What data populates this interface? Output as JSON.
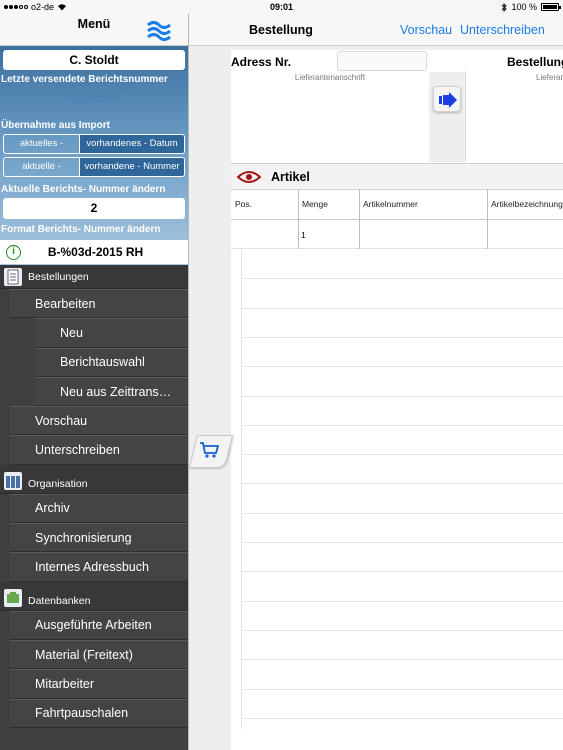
{
  "status_bar": {
    "carrier": "o2-de",
    "time": "09:01",
    "battery": "100 %",
    "battery_level": 1.0
  },
  "sidebar": {
    "title": "Menü",
    "user": "C. Stoldt",
    "last_report_label": "Letzte versendete Berichtsnummer",
    "number_placeholder": "Nummer",
    "import_label": "Übernahme aus Import",
    "import_date": {
      "left": "aktuelles -",
      "right": "vorhandenes - Datum"
    },
    "import_number": {
      "left": "aktuelle -",
      "right": "vorhandene - Nummer"
    },
    "change_number_label": "Aktuelle Berichts- Nummer ändern",
    "current_number": "2",
    "change_format_label": "Format Berichts- Nummer ändern",
    "format_value": "B-%03d-2015 RH",
    "sections": {
      "orders": "Bestellungen",
      "organisation": "Organisation",
      "databases": "Datenbanken"
    },
    "items": {
      "edit": "Bearbeiten",
      "new": "Neu",
      "report_selection": "Berichtauswahl",
      "new_from_time": "Neu aus Zeittrans…",
      "preview": "Vorschau",
      "sign": "Unterschreiben",
      "archive": "Archiv",
      "sync": "Synchronisierung",
      "address_book": "Internes Adressbuch",
      "work_done": "Ausgeführte Arbeiten",
      "material": "Material (Freitext)",
      "staff": "Mitarbeiter",
      "travel": "Fahrtpauschalen"
    }
  },
  "main": {
    "title": "Bestellung",
    "preview_button": "Vorschau",
    "sign_button": "Unterschreiben",
    "address_label": "Adress Nr.",
    "order_label": "Bestellung",
    "supplier_address_caption": "Lieferantenanschrift",
    "delivery_caption": "Lieferan",
    "articles_title": "Artikel",
    "columns": [
      "Pos.",
      "Menge",
      "Artikelnummer",
      "Artikelbezeichnung"
    ],
    "rows": [
      {
        "pos": "",
        "menge": "1",
        "artikelnummer": "",
        "bezeichnung": ""
      }
    ]
  },
  "colors": {
    "accent": "#1a7de8",
    "sidebar_bg": "#444444",
    "panel_top": "#3b6f9e"
  }
}
